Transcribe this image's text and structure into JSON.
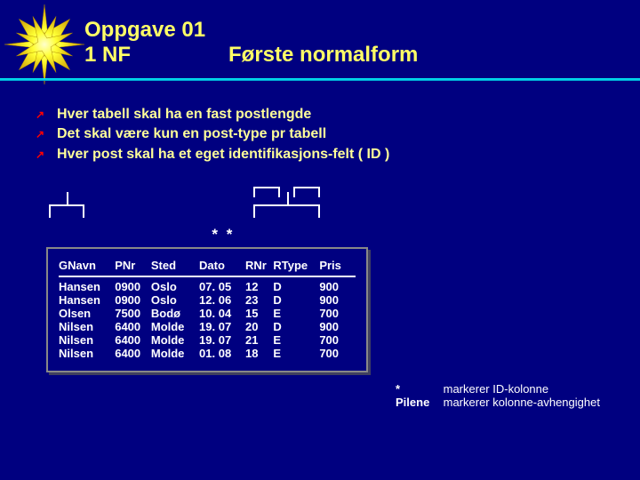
{
  "header": {
    "line1": "Oppgave 01",
    "line2a": "1 NF",
    "line2b": "Første normalform"
  },
  "bullets": [
    "Hver tabell skal ha en fast postlengde",
    "Det skal være kun en post-type pr tabell",
    "Hver post skal ha et eget identifikasjons-felt ( ID )"
  ],
  "asterisk": "*",
  "table": {
    "headers": [
      "GNavn",
      "PNr",
      "Sted",
      "Dato",
      "RNr",
      "RType",
      "Pris"
    ],
    "rows": [
      [
        "Hansen",
        "0900",
        "Oslo",
        "07. 05",
        "12",
        "D",
        "900"
      ],
      [
        "Hansen",
        "0900",
        "Oslo",
        "12. 06",
        "23",
        "D",
        "900"
      ],
      [
        "Olsen",
        "7500",
        "Bodø",
        "10. 04",
        "15",
        "E",
        "700"
      ],
      [
        "Nilsen",
        "6400",
        "Molde",
        "19. 07",
        "20",
        "D",
        "900"
      ],
      [
        "Nilsen",
        "6400",
        "Molde",
        "19. 07",
        "21",
        "E",
        "700"
      ],
      [
        "Nilsen",
        "6400",
        "Molde",
        "01. 08",
        "18",
        "E",
        "700"
      ]
    ]
  },
  "footnote": {
    "l1a": "*",
    "l1b": "markerer ID-kolonne",
    "l2a": "Pilene",
    "l2b": "markerer kolonne-avhengighet"
  }
}
